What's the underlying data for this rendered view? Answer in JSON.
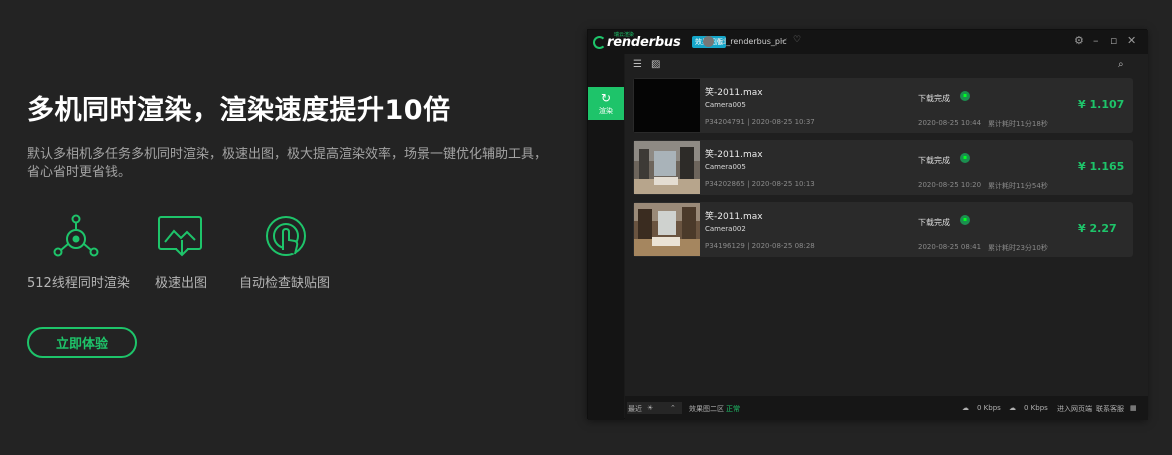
{
  "headline": "多机同时渲染，渲染速度提升10倍",
  "description": "默认多相机多任务多机同时渲染，极速出图，极大提高渲染效率，场景一键优化辅助工具，省心省时更省钱。",
  "features": [
    {
      "icon": "multi-node-icon",
      "label": "512线程同时渲染"
    },
    {
      "icon": "fast-image-download-icon",
      "label": "极速出图"
    },
    {
      "icon": "touch-scan-icon",
      "label": "自动检查缺贴图"
    }
  ],
  "cta_label": "立即体验",
  "app": {
    "brand": "renderbus",
    "brand_small": "瑞云渲染",
    "tag": "效果图版",
    "username": "td_renderbus_pic",
    "sidebar_render_label": "渲染",
    "jobs": [
      {
        "name": "笑-2011.max",
        "camera": "Camera005",
        "id_date": "P34204791 | 2020-08-25 10:37",
        "status": "下载完成",
        "done_time": "2020-08-25 10:44",
        "duration": "累计耗时11分18秒",
        "price": "¥ 1.107",
        "thumb": "black"
      },
      {
        "name": "笑-2011.max",
        "camera": "Camera005",
        "id_date": "P34202865 | 2020-08-25 10:13",
        "status": "下载完成",
        "done_time": "2020-08-25 10:20",
        "duration": "累计耗时11分54秒",
        "price": "¥ 1.165",
        "thumb": "room"
      },
      {
        "name": "笑-2011.max",
        "camera": "Camera002",
        "id_date": "P34196129 | 2020-08-25 08:28",
        "status": "下载完成",
        "done_time": "2020-08-25 08:41",
        "duration": "累计耗时23分10秒",
        "price": "¥ 2.27",
        "thumb": "room2"
      }
    ],
    "statusbar": {
      "select_value": "最近",
      "region": "效果图二区",
      "region_status": "正常",
      "up_speed": "0 Kbps",
      "down_speed": "0 Kbps",
      "web_link": "进入网页端",
      "contact": "联系客服"
    }
  }
}
